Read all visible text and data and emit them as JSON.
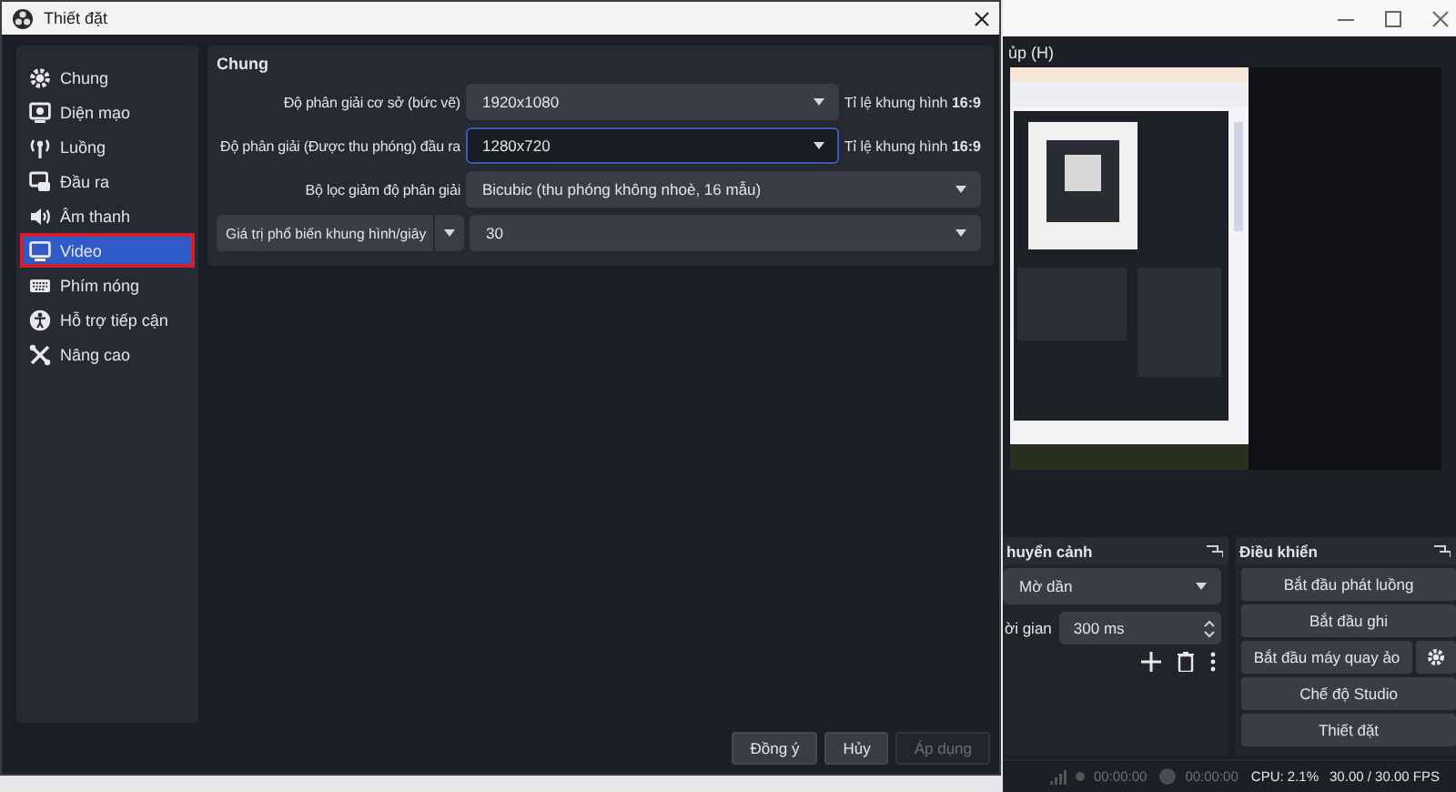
{
  "settings_dialog": {
    "title": "Thiết đặt",
    "sidebar": [
      {
        "label": "Chung",
        "selected": false
      },
      {
        "label": "Diện mạo",
        "selected": false
      },
      {
        "label": "Luồng",
        "selected": false
      },
      {
        "label": "Đầu ra",
        "selected": false
      },
      {
        "label": "Âm thanh",
        "selected": false
      },
      {
        "label": "Video",
        "selected": true
      },
      {
        "label": "Phím nóng",
        "selected": false
      },
      {
        "label": "Hỗ trợ tiếp cận",
        "selected": false
      },
      {
        "label": "Nâng cao",
        "selected": false
      }
    ],
    "section_title": "Chung",
    "rows": [
      {
        "kind": "combo",
        "label": "Độ phân giải cơ sở (bức vẽ)",
        "value": "1920x1080",
        "focused": false,
        "aspect": "Tỉ lệ khung hình **16:9**"
      },
      {
        "kind": "combo",
        "label": "Độ phân giải (Được thu phóng) đầu ra",
        "value": "1280x720",
        "focused": true,
        "aspect": "Tỉ lệ khung hình **16:9**"
      },
      {
        "kind": "combo",
        "label": "Bộ lọc giảm độ phân giải",
        "value": "Bicubic (thu phóng không nhoè, 16 mẫu)",
        "focused": false
      },
      {
        "kind": "select_label",
        "label": "Giá trị phổ biến khung hình/giây",
        "value": "30",
        "focused": false
      }
    ],
    "buttons": [
      {
        "label": "Đồng ý",
        "disabled": false
      },
      {
        "label": "Hủy",
        "disabled": false
      },
      {
        "label": "Áp dụng",
        "disabled": true
      }
    ]
  },
  "main_window": {
    "menu_item": "ủp (H)",
    "transitions": {
      "title": "huyển cảnh",
      "transition": "Mờ dần",
      "duration_label": "ời gian",
      "duration": "300 ms"
    },
    "controls": {
      "title": "Điều khiển",
      "buttons": [
        {
          "label": "Bắt đầu phát luồng",
          "kind": "plain"
        },
        {
          "label": "Bắt đầu ghi",
          "kind": "plain"
        },
        {
          "label": "Bắt đầu máy quay ảo",
          "kind": "with_settings"
        },
        {
          "label": "Chế độ Studio",
          "kind": "plain"
        },
        {
          "label": "Thiết đặt",
          "kind": "plain"
        }
      ]
    },
    "status_bar": {
      "record_time": "00:00:00",
      "stream_time": "00:00:00",
      "cpu": "CPU: 2.1%",
      "fps": "30.00 / 30.00 FPS"
    }
  }
}
